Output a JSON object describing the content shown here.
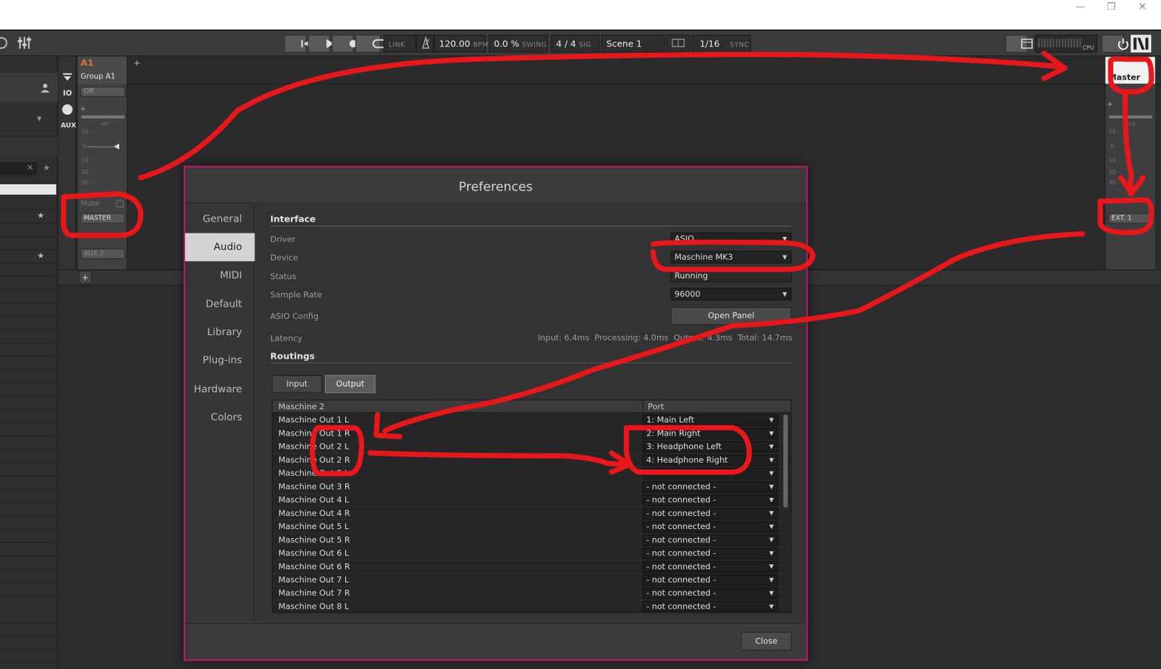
{
  "window": {
    "controls": {
      "minimize": "—",
      "restore": "❐",
      "close": "✕"
    }
  },
  "toolbar": {
    "link_label": "LINK",
    "tempo": "120.00",
    "tempo_unit": "BPM",
    "swing": "0.0 %",
    "swing_unit": "SWING",
    "signature": "4 / 4",
    "signature_unit": "SIG",
    "scene": "Scene 1",
    "quantize": "1/16",
    "sync_label": "SYNC",
    "cpu_label": "CPU"
  },
  "mixer": {
    "group_id": "A1",
    "group_name": "Group A1",
    "group_off": "Off",
    "io_label": "IO",
    "aux_label": "AUX",
    "meter_inf": "-inf",
    "meter_scale": [
      "10 -",
      "0 -",
      "10 -",
      "20 -",
      "30 -"
    ],
    "mute_label": "Mute",
    "group_output": "MASTER",
    "aux2_label": "AUX 2",
    "master_name": "Master",
    "master_output": "EXT. 1",
    "add_symbol": "+"
  },
  "preferences": {
    "title": "Preferences",
    "nav": [
      "General",
      "Audio",
      "MIDI",
      "Default",
      "Library",
      "Plug-ins",
      "Hardware",
      "Colors"
    ],
    "active_nav": "Audio",
    "interface": {
      "title": "Interface",
      "driver_label": "Driver",
      "driver_value": "ASIO",
      "device_label": "Device",
      "device_value": "Maschine MK3",
      "status_label": "Status",
      "status_value": "Running",
      "sample_rate_label": "Sample Rate",
      "sample_rate_value": "96000",
      "asio_config_label": "ASIO Config",
      "open_panel_label": "Open Panel",
      "latency_label": "Latency",
      "latency_value": "Input: 6.4ms  Processing: 4.0ms  Output: 4.3ms  Total: 14.7ms"
    },
    "routings": {
      "title": "Routings",
      "tabs": [
        "Input",
        "Output"
      ],
      "active_tab": "Output",
      "col_source": "Maschine 2",
      "col_port": "Port",
      "rows": [
        {
          "name": "Maschine Out 1 L",
          "port": "1: Main Left"
        },
        {
          "name": "Maschine Out 1 R",
          "port": "2: Main Right"
        },
        {
          "name": "Maschine Out 2 L",
          "port": "3: Headphone Left"
        },
        {
          "name": "Maschine Out 2 R",
          "port": "4: Headphone Right"
        },
        {
          "name": "Maschine Out 3 L",
          "port": ""
        },
        {
          "name": "Maschine Out 3 R",
          "port": "- not connected -"
        },
        {
          "name": "Maschine Out 4 L",
          "port": "- not connected -"
        },
        {
          "name": "Maschine Out 4 R",
          "port": "- not connected -"
        },
        {
          "name": "Maschine Out 5 L",
          "port": "- not connected -"
        },
        {
          "name": "Maschine Out 5 R",
          "port": "- not connected -"
        },
        {
          "name": "Maschine Out 6 L",
          "port": "- not connected -"
        },
        {
          "name": "Maschine Out 6 R",
          "port": "- not connected -"
        },
        {
          "name": "Maschine Out 7 L",
          "port": "- not connected -"
        },
        {
          "name": "Maschine Out 7 R",
          "port": "- not connected -"
        },
        {
          "name": "Maschine Out 8 L",
          "port": "- not connected -"
        }
      ]
    },
    "close_label": "Close"
  },
  "colors": {
    "dialog_border": "#c3196a",
    "annotation_red": "#e8171b",
    "group_accent": "#e0703a"
  },
  "icons": {
    "prev": "skip-back-icon",
    "play": "play-icon",
    "record": "record-icon",
    "loop": "loop-icon",
    "metronome": "metronome-icon",
    "mixer": "mixer-sliders-icon",
    "power": "power-icon",
    "ni_logo": "ni-logo-icon",
    "user": "user-icon",
    "star": "star-icon"
  }
}
